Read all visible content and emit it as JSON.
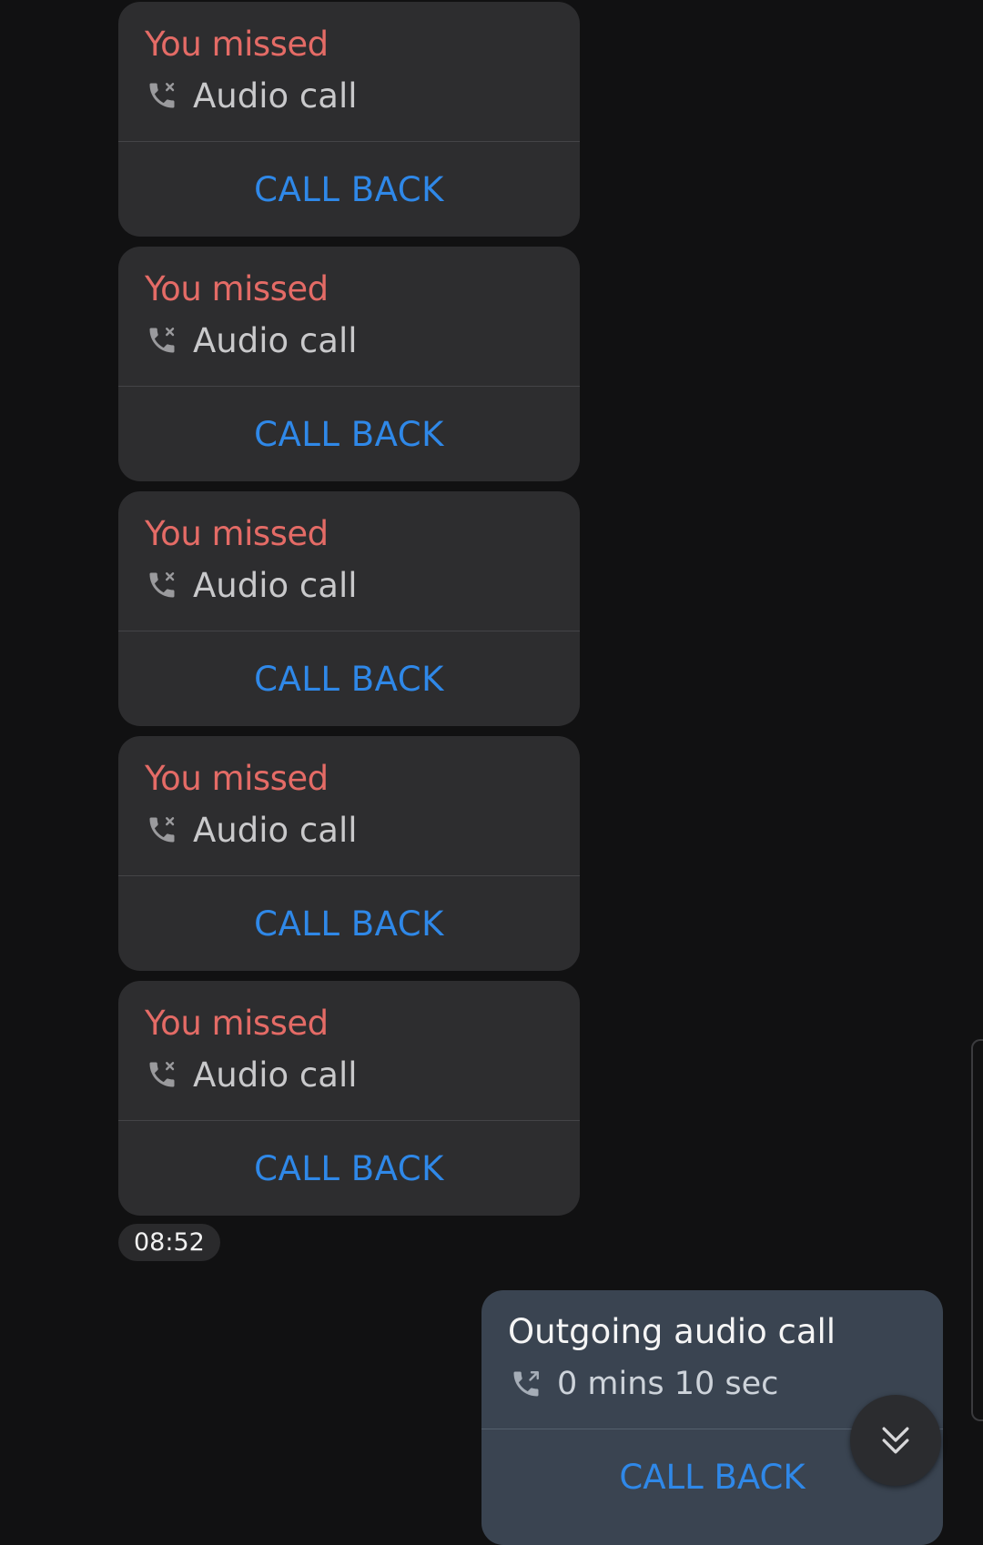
{
  "missed_calls": [
    {
      "title": "You missed",
      "type": "Audio call",
      "action": "CALL BACK",
      "icon": "missed-call-icon"
    },
    {
      "title": "You missed",
      "type": "Audio call",
      "action": "CALL BACK",
      "icon": "missed-call-icon"
    },
    {
      "title": "You missed",
      "type": "Audio call",
      "action": "CALL BACK",
      "icon": "missed-call-icon"
    },
    {
      "title": "You missed",
      "type": "Audio call",
      "action": "CALL BACK",
      "icon": "missed-call-icon"
    },
    {
      "title": "You missed",
      "type": "Audio call",
      "action": "CALL BACK",
      "icon": "missed-call-icon"
    }
  ],
  "timestamp": "08:52",
  "outgoing_call": {
    "title": "Outgoing audio call",
    "duration": "0 mins 10 sec",
    "action": "CALL BACK",
    "icon": "outgoing-call-icon"
  },
  "scroll_button_icon": "double-chevron-down-icon",
  "colors": {
    "background": "#111112",
    "missed_card": "#2d2d2f",
    "outgoing_card": "#3a4451",
    "missed_title": "#e46b66",
    "action_blue": "#2f88e8"
  }
}
